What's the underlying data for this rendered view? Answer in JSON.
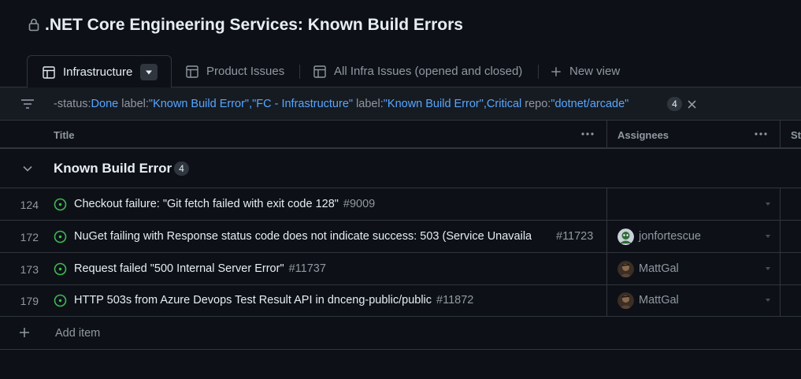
{
  "header": {
    "title": ".NET Core Engineering Services: Known Build Errors",
    "lock_icon": "lock-icon"
  },
  "tabs": [
    {
      "label": "Infrastructure",
      "icon": "table-icon",
      "active": true
    },
    {
      "label": "Product Issues",
      "icon": "table-icon",
      "active": false
    },
    {
      "label": "All Infra Issues (opened and closed)",
      "icon": "table-icon",
      "active": false
    },
    {
      "label": "New view",
      "icon": "plus-icon",
      "active": false
    }
  ],
  "filter": {
    "parts": [
      {
        "text": "-status:",
        "kind": "key"
      },
      {
        "text": "Done",
        "kind": "val"
      },
      {
        "text": " label:",
        "kind": "key"
      },
      {
        "text": "\"Known Build Error\",\"FC - Infrastructure\"",
        "kind": "val"
      },
      {
        "text": " label:",
        "kind": "key"
      },
      {
        "text": "\"Known Build Error\",Critical",
        "kind": "val"
      },
      {
        "text": " repo:",
        "kind": "key"
      },
      {
        "text": "\"dotnet/arcade\"",
        "kind": "val"
      }
    ],
    "count": "4"
  },
  "columns": {
    "title": "Title",
    "assignees": "Assignees",
    "status_truncated": "St"
  },
  "group": {
    "label": "Known Build Error",
    "count": "4"
  },
  "rows": [
    {
      "num": "124",
      "title": "Checkout failure: \"Git fetch failed with exit code 128\"",
      "ref": "#9009",
      "assignee": ""
    },
    {
      "num": "172",
      "title": "NuGet failing with Response status code does not indicate success: 503 (Service Unavaila",
      "ref": "#11723",
      "assignee": "jonfortescue"
    },
    {
      "num": "173",
      "title": "Request failed \"500 Internal Server Error\"",
      "ref": "#11737",
      "assignee": "MattGal"
    },
    {
      "num": "179",
      "title": "HTTP 503s from Azure Devops Test Result API in dnceng-public/public",
      "ref": "#11872",
      "assignee": "MattGal"
    }
  ],
  "add_item": {
    "label": "Add item"
  },
  "colors": {
    "background": "#0d1117",
    "border": "#30363d",
    "muted": "#9198a1",
    "link": "#58a6ff",
    "open_issue": "#3fb950"
  }
}
